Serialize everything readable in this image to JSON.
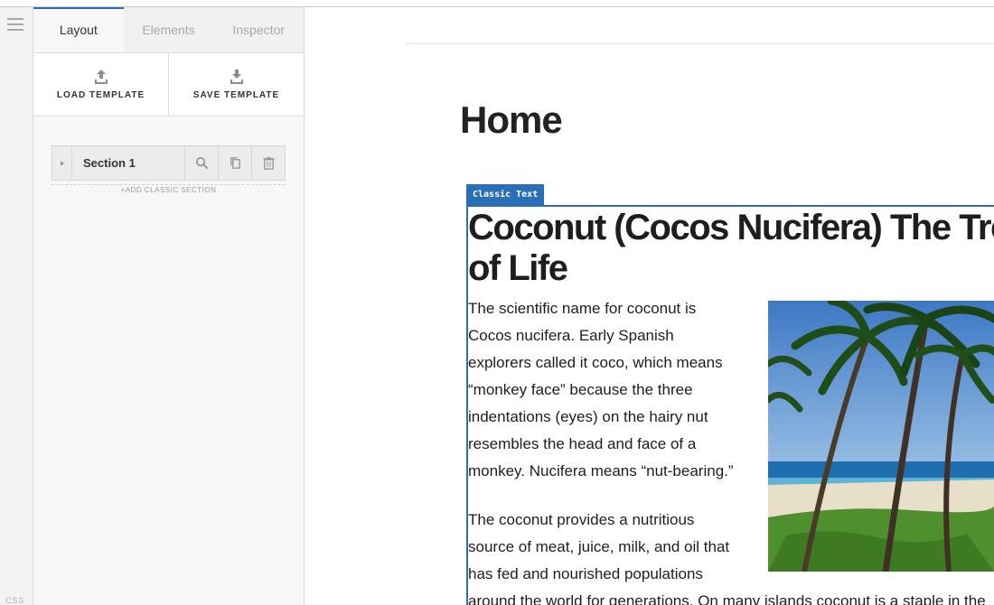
{
  "sidebar": {
    "tabs": [
      {
        "label": "Layout",
        "active": true
      },
      {
        "label": "Elements",
        "active": false
      },
      {
        "label": "Inspector",
        "active": false
      }
    ],
    "templates": {
      "load_label": "LOAD TEMPLATE",
      "save_label": "SAVE TEMPLATE"
    },
    "sections": [
      {
        "name": "Section 1"
      }
    ],
    "add_section_label": "+ADD CLASSIC SECTION",
    "rail_label": "CSS"
  },
  "canvas": {
    "page_title": "Home",
    "module_badge": "Classic Text",
    "article": {
      "title": "Coconut (Cocos Nucifera) The Tree of Life",
      "paragraph1": "The scientific name for coconut is Cocos nucifera. Early Spanish explorers called it coco, which means “monkey face” because the three indentations (eyes) on the hairy nut resembles the head and face of a monkey. Nucifera means “nut-bearing.”",
      "paragraph2": "The coconut provides a nutritious source of meat, juice, milk, and oil that has fed and nourished populations",
      "paragraph3": "around the world for generations. On many islands coconut is a staple in the"
    }
  },
  "colors": {
    "accent": "#2a6fb5",
    "panel_bg": "#f7f7f7",
    "text": "#1e1e1e"
  },
  "icons": [
    "menu-icon",
    "upload-icon",
    "download-icon",
    "search-icon",
    "copy-icon",
    "trash-icon"
  ]
}
